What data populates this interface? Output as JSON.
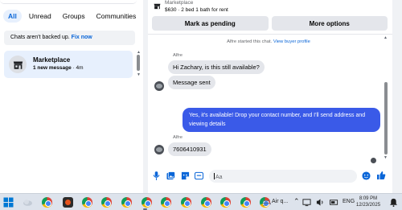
{
  "tabs": [
    {
      "label": "All",
      "active": true
    },
    {
      "label": "Unread",
      "active": false
    },
    {
      "label": "Groups",
      "active": false
    },
    {
      "label": "Communities",
      "active": false
    }
  ],
  "backup": {
    "text": "Chats aren't backed up.",
    "link": "Fix now"
  },
  "chat_list": [
    {
      "name": "Marketplace",
      "sub_bold": "1 new message",
      "sub_time": " · 4m",
      "icon": "storefront-icon"
    }
  ],
  "conversation": {
    "header_title": "Marketplace",
    "listing": "$630 · 2 bed 1 bath for rent",
    "buttons": {
      "pending": "Mark as pending",
      "more": "More options"
    },
    "started_text": "Alfre started this chat.",
    "started_link": "View buyer profile",
    "messages": [
      {
        "from": "Alfre",
        "direction": "in",
        "text": "Hi Zachary, is this still available?"
      },
      {
        "from": "Alfre",
        "direction": "in",
        "text": "Message sent"
      },
      {
        "from": "me",
        "direction": "out",
        "line1": "Yes, it's available! Drop your contact number, and I'll send address and",
        "line2": "viewing details"
      },
      {
        "from": "Alfre",
        "direction": "in",
        "text": "7606410931"
      }
    ],
    "composer": {
      "placeholder": "Aa"
    }
  },
  "taskbar": {
    "weather_text": "Air q...",
    "lang": "ENG",
    "time": "8:09 PM",
    "date": "12/23/2025"
  },
  "colors": {
    "accent": "#0a66d8",
    "outgoing_bubble": "#3a5ae8",
    "incoming_bubble": "#e4e6eb"
  }
}
